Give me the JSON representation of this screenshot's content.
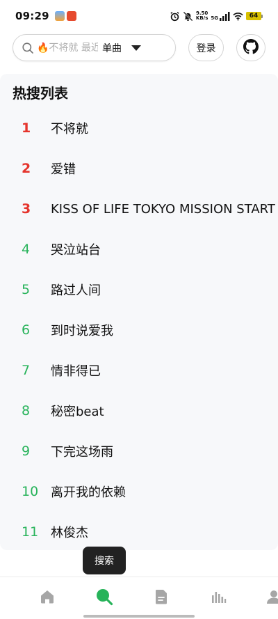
{
  "status_bar": {
    "time": "09:29",
    "net_speed_value": "9.50",
    "net_speed_unit": "KB/s",
    "signal_label": "5G",
    "battery": "64"
  },
  "search": {
    "placeholder": "🔥不将就 最近",
    "type_selected": "单曲"
  },
  "header": {
    "login_label": "登录"
  },
  "hot_search": {
    "title": "热搜列表",
    "items": [
      {
        "rank": "1",
        "name": "不将就"
      },
      {
        "rank": "2",
        "name": "爱错"
      },
      {
        "rank": "3",
        "name": "KISS OF LIFE TOKYO MISSION START"
      },
      {
        "rank": "4",
        "name": "哭泣站台"
      },
      {
        "rank": "5",
        "name": "路过人间"
      },
      {
        "rank": "6",
        "name": "到时说爱我"
      },
      {
        "rank": "7",
        "name": "情非得已"
      },
      {
        "rank": "8",
        "name": "秘密beat"
      },
      {
        "rank": "9",
        "name": "下完这场雨"
      },
      {
        "rank": "10",
        "name": "离开我的依赖"
      },
      {
        "rank": "11",
        "name": "林俊杰"
      }
    ]
  },
  "toast": {
    "text": "搜索"
  },
  "bottom_nav": {
    "items": [
      {
        "icon": "home-icon"
      },
      {
        "icon": "search-icon",
        "active": true
      },
      {
        "icon": "document-icon"
      },
      {
        "icon": "chart-icon"
      },
      {
        "icon": "user-icon"
      }
    ]
  },
  "colors": {
    "accent": "#27b35a",
    "top_rank": "#e5342c",
    "nav_icon": "#a6a6a6"
  }
}
